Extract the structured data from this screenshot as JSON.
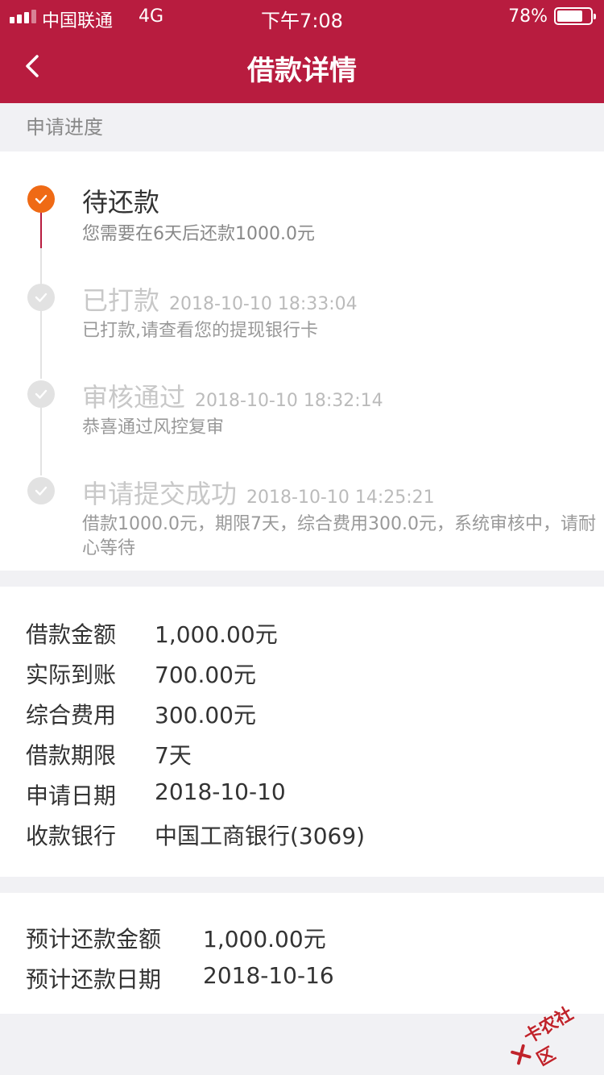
{
  "status_bar": {
    "carrier": "中国联通",
    "network": "4G",
    "time": "下午7:08",
    "battery_pct": "78%",
    "battery_level": 0.78
  },
  "header": {
    "title": "借款详情",
    "back_icon": "chevron-left-icon"
  },
  "progress": {
    "label": "申请进度",
    "steps": [
      {
        "title": "待还款",
        "time": "",
        "desc": "您需要在6天后还款1000.0元",
        "active": true
      },
      {
        "title": "已打款",
        "time": "2018-10-10 18:33:04",
        "desc": "已打款,请查看您的提现银行卡",
        "active": false
      },
      {
        "title": "审核通过",
        "time": "2018-10-10 18:32:14",
        "desc": "恭喜通过风控复审",
        "active": false
      },
      {
        "title": "申请提交成功",
        "time": "2018-10-10 14:25:21",
        "desc": "借款1000.0元，期限7天，综合费用300.0元，系统审核中，请耐心等待",
        "active": false
      }
    ]
  },
  "details": [
    {
      "label": "借款金额",
      "value": "1,000.00元"
    },
    {
      "label": "实际到账",
      "value": "700.00元"
    },
    {
      "label": "综合费用",
      "value": "300.00元"
    },
    {
      "label": "借款期限",
      "value": "7天"
    },
    {
      "label": "申请日期",
      "value": "2018-10-10"
    },
    {
      "label": "收款银行",
      "value": "中国工商银行(3069)"
    }
  ],
  "summary": [
    {
      "label": "预计还款金额",
      "value": "1,000.00元"
    },
    {
      "label": "预计还款日期",
      "value": "2018-10-16"
    }
  ],
  "watermark": {
    "text": "卡农社区"
  },
  "colors": {
    "brand": "#b81c3f",
    "active_dot": "#ef6a15",
    "inactive_dot": "#e2e2e2"
  }
}
